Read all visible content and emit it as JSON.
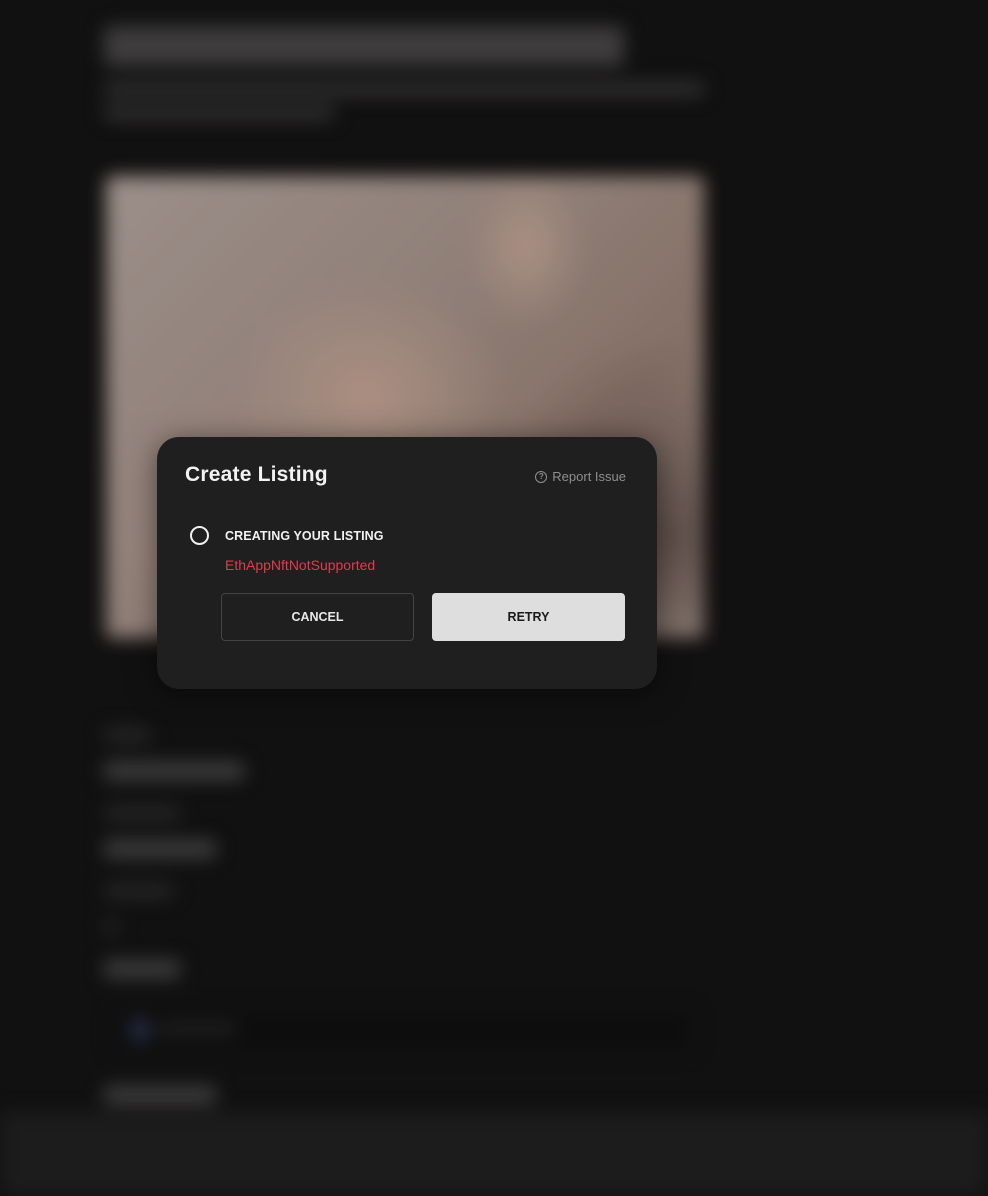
{
  "modal": {
    "title": "Create Listing",
    "report_label": "Report Issue",
    "report_icon": "help-circle-icon",
    "step": {
      "label": "CREATING YOUR LISTING",
      "error": "EthAppNftNotSupported",
      "error_color": "#e5394d"
    },
    "buttons": {
      "cancel": "CANCEL",
      "retry": "RETRY"
    }
  }
}
